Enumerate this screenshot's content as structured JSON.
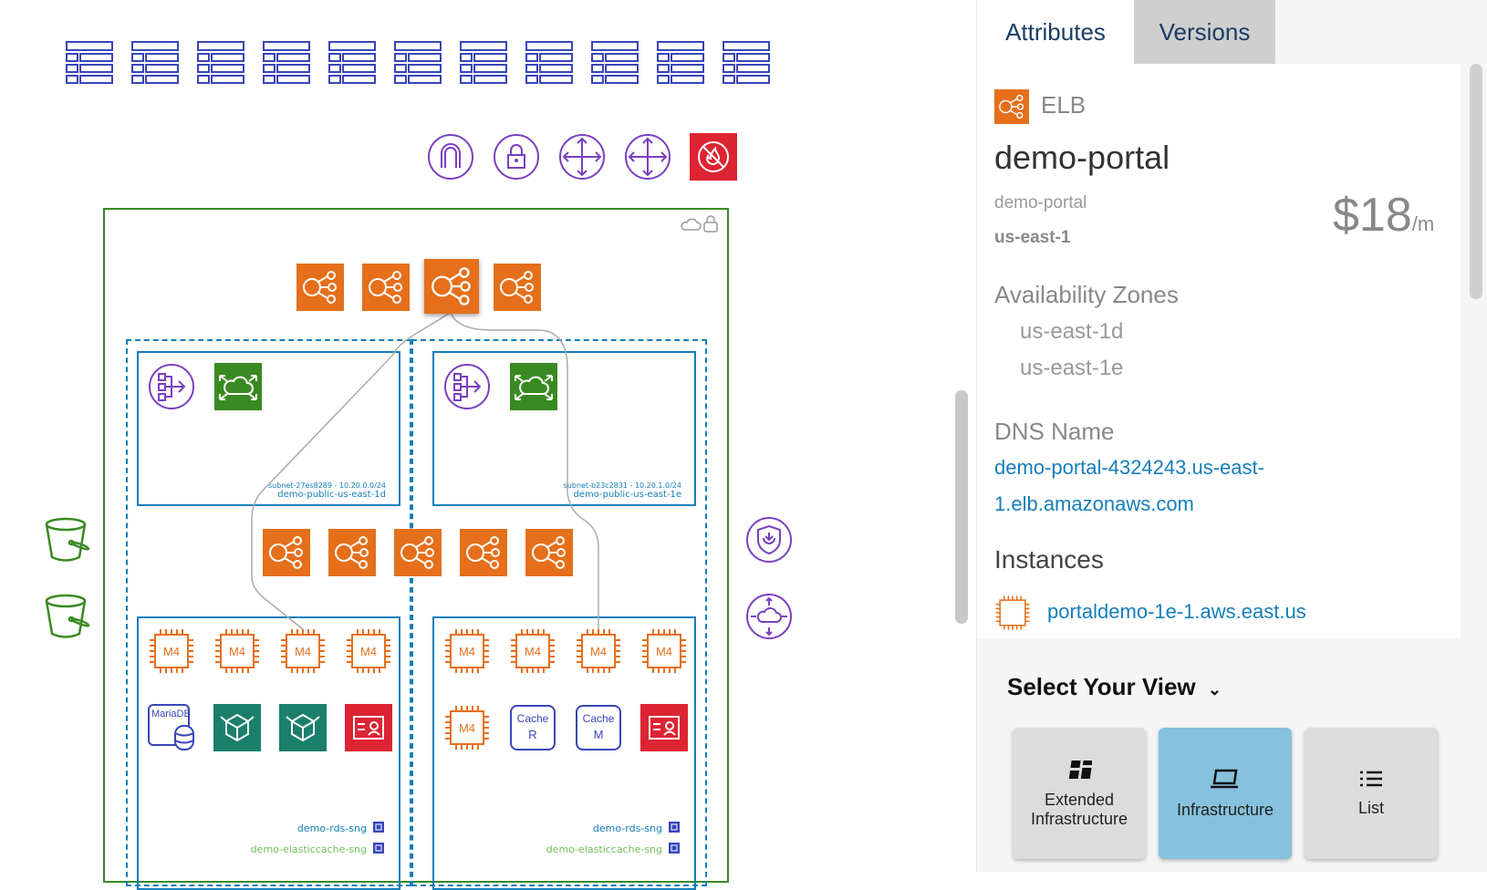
{
  "diagram": {
    "subnets": [
      {
        "id": "subnet-27es8289 - 10.20.0.0/24",
        "name": "demo-public-us-east-1d"
      },
      {
        "id": "subnet-b23c2831 - 10.20.1.0/24",
        "name": "demo-public-us-east-1e"
      }
    ],
    "instance_label": "M4",
    "db_labels": {
      "mariadb": "MariaDB",
      "cache_r": "Cache",
      "cache_r_letter": "R",
      "cache_m": "Cache",
      "cache_m_letter": "M"
    },
    "sng_labels": [
      {
        "rds": "demo-rds-sng",
        "cache": "demo-elasticcache-sng"
      },
      {
        "rds": "demo-rds-sng",
        "cache": "demo-elasticcache-sng"
      }
    ],
    "colors": {
      "orange": "#e56f1a",
      "green": "#3a8a23",
      "purple": "#7a3fc0",
      "red": "#dd2433",
      "teal": "#1a7f6b",
      "blue": "#147eba",
      "navy": "#3845b8"
    }
  },
  "panel": {
    "tabs": [
      {
        "label": "Attributes",
        "active": true
      },
      {
        "label": "Versions",
        "active": false
      }
    ],
    "resource_type": "ELB",
    "resource_name": "demo-portal",
    "resource_id": "demo-portal",
    "region": "us-east-1",
    "price": "$18",
    "price_unit": "/m",
    "availability_zones_title": "Availability Zones",
    "availability_zones": [
      "us-east-1d",
      "us-east-1e"
    ],
    "dns_title": "DNS Name",
    "dns_line1": "demo-portal-4324243.us-east-",
    "dns_line2": "1.elb.amazonaws.com",
    "instances_title": "Instances",
    "instance_link": "portaldemo-1e-1.aws.east.us"
  },
  "view_selector": {
    "title": "Select Your View",
    "options": [
      {
        "line1": "Extended",
        "line2": "Infrastructure",
        "icon": "dashboard-icon",
        "active": false
      },
      {
        "line1": "Infrastructure",
        "icon": "laptop-icon",
        "active": true
      },
      {
        "line1": "List",
        "icon": "list-icon",
        "active": false
      }
    ]
  }
}
